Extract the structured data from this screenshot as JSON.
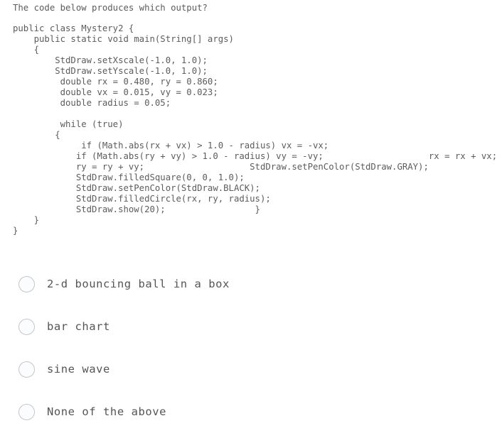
{
  "question": {
    "prompt": "The code below produces which output?"
  },
  "code": {
    "language": "java",
    "lines": [
      "public class Mystery2 {",
      "    public static void main(String[] args)",
      "    {",
      "        StdDraw.setXscale(-1.0, 1.0);",
      "        StdDraw.setYscale(-1.0, 1.0);",
      "         double rx = 0.480, ry = 0.860;",
      "         double vx = 0.015, vy = 0.023;",
      "         double radius = 0.05;",
      "",
      "         while (true)",
      "        {",
      "             if (Math.abs(rx + vx) > 1.0 - radius) vx = -vx;",
      "            if (Math.abs(ry + vy) > 1.0 - radius) vy = -vy;                    rx = rx + vx;",
      "            ry = ry + vy;                    StdDraw.setPenColor(StdDraw.GRAY);",
      "            StdDraw.filledSquare(0, 0, 1.0);",
      "            StdDraw.setPenColor(StdDraw.BLACK);",
      "            StdDraw.filledCircle(rx, ry, radius);",
      "            StdDraw.show(20);                 }",
      "    }",
      "}"
    ]
  },
  "options": [
    {
      "id": "option-a",
      "label": "2-d bouncing ball in a box",
      "selected": false
    },
    {
      "id": "option-b",
      "label": "bar chart",
      "selected": false
    },
    {
      "id": "option-c",
      "label": "sine wave",
      "selected": false
    },
    {
      "id": "option-d",
      "label": "None of the above",
      "selected": false
    }
  ],
  "colors": {
    "background": "#ffffff",
    "text": "#5c5c5c",
    "option_text": "#555555",
    "radio_border": "#c3c6cb",
    "radio_fill": "#fbfcfd"
  }
}
